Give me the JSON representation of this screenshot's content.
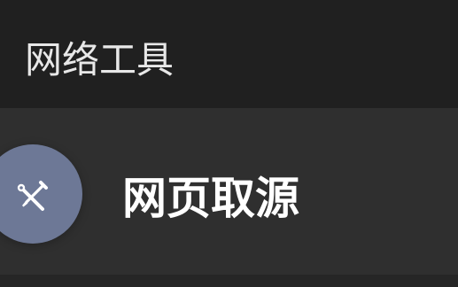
{
  "header": {
    "title": "网络工具"
  },
  "list": {
    "items": [
      {
        "title": "网页取源",
        "icon": "tools-icon"
      }
    ]
  },
  "colors": {
    "header_bg": "#202020",
    "item_bg": "#2f2f2f",
    "icon_circle": "#6d7896",
    "title_text": "#ffffff"
  }
}
